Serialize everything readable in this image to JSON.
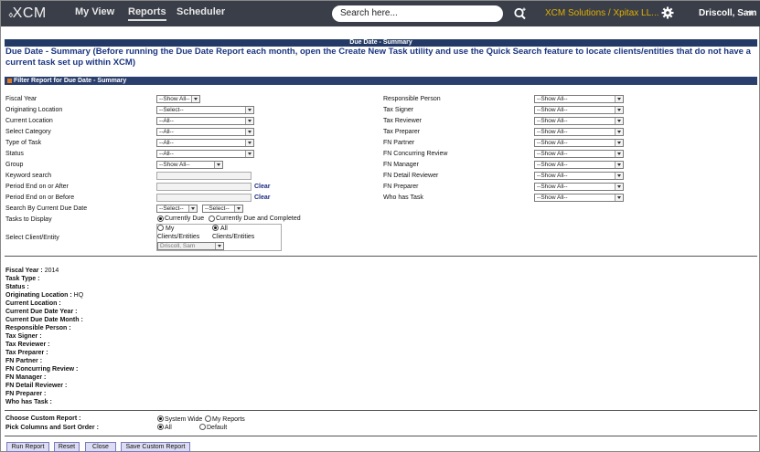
{
  "header": {
    "logo": "XCM",
    "nav": [
      "My View",
      "Reports",
      "Scheduler"
    ],
    "search_placeholder": "Search here...",
    "company": "XCM Solutions / Xpitax LL...",
    "user": "Driscoll, Sam"
  },
  "page_title": "Due Date - Summary",
  "description": "Due Date - Summary (Before running the Due Date Report each month, open the Create New Task utility and use the Quick Search feature to locate clients/entities that do not have a current task set up within XCM)",
  "filter_title": "Filter Report for Due Date - Summary",
  "left_labels": [
    "Fiscal Year",
    "Originating Location",
    "Current Location",
    "Select Category",
    "Type of Task",
    "Status",
    "Group",
    "Keyword search",
    "Period End on or After",
    "Period End on or Before",
    "Search By Current Due Date",
    "Tasks to Display",
    "Select Client/Entity"
  ],
  "left_selects": [
    "--Show All--",
    "--Select--",
    "--All--",
    "--All--",
    "--All--",
    "--All--",
    "--Show All--"
  ],
  "due_date_selects": [
    "--Select--",
    "--Select--"
  ],
  "clear_label": "Clear",
  "tasks_display": [
    "Currently Due",
    "Currently Due and Completed"
  ],
  "client_options": [
    "My Clients/Entities",
    "All Clients/Entities"
  ],
  "client_select": "Driscoll, Sam",
  "right_labels": [
    "Responsible Person",
    "Tax Signer",
    "Tax Reviewer",
    "Tax Preparer",
    "FN Partner",
    "FN Concurring Review",
    "FN Manager",
    "FN Detail Reviewer",
    "FN Preparer",
    "Who has Task"
  ],
  "right_selects": [
    "--Show All--",
    "--Show All--",
    "--Show All--",
    "--Show All--",
    "--Show All--",
    "--Show All--",
    "--Show All--",
    "--Show All--",
    "--Show All--",
    "--Show All--"
  ],
  "summary": [
    {
      "label": "Fiscal Year :",
      "value": "2014"
    },
    {
      "label": "Task Type :",
      "value": ""
    },
    {
      "label": "Status :",
      "value": ""
    },
    {
      "label": "Originating Location :",
      "value": "HQ"
    },
    {
      "label": "Current Location :",
      "value": ""
    },
    {
      "label": "Current Due Date Year :",
      "value": ""
    },
    {
      "label": "Current Due Date Month :",
      "value": ""
    },
    {
      "label": "Responsible Person :",
      "value": ""
    },
    {
      "label": "Tax Signer :",
      "value": ""
    },
    {
      "label": "Tax Reviewer :",
      "value": ""
    },
    {
      "label": "Tax Preparer :",
      "value": ""
    },
    {
      "label": "FN Partner :",
      "value": ""
    },
    {
      "label": "FN Concurring Review :",
      "value": ""
    },
    {
      "label": "FN Manager :",
      "value": ""
    },
    {
      "label": "FN Detail Reviewer :",
      "value": ""
    },
    {
      "label": "FN Preparer :",
      "value": ""
    },
    {
      "label": "Who has Task :",
      "value": ""
    }
  ],
  "custom_report_label": "Choose Custom Report :",
  "custom_report_options": [
    "System Wide",
    "My Reports"
  ],
  "columns_label": "Pick Columns and Sort Order :",
  "columns_options": [
    "All",
    "Default"
  ],
  "buttons": [
    "Run Report",
    "Reset",
    "Close",
    "Save Custom Report"
  ]
}
